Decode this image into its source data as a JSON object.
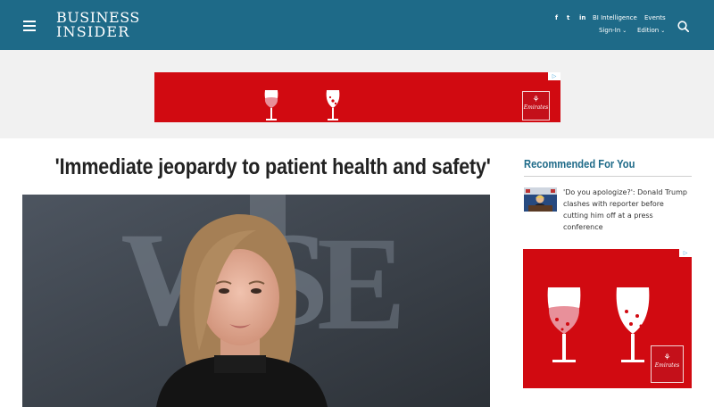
{
  "header": {
    "logo": {
      "line1": "BUSINESS",
      "line2": "INSIDER"
    },
    "social": {
      "facebook": "f",
      "twitter": "t",
      "linkedin": "in"
    },
    "links": {
      "bi_intelligence": "BI Intelligence",
      "events": "Events",
      "sign_in": "Sign-In",
      "edition": "Edition"
    }
  },
  "ads": {
    "adchoices": "▷",
    "top": {
      "brand_mark": "⚘",
      "brand_name": "Emirates"
    },
    "side": {
      "brand_mark": "⚘",
      "brand_name": "Emirates"
    }
  },
  "article": {
    "headline": "'Immediate jeopardy to patient health and safety'"
  },
  "sidebar": {
    "title": "Recommended For You",
    "items": [
      {
        "text": "'Do you apologize?': Donald Trump clashes with reporter before cutting him off at a press conference"
      }
    ]
  },
  "colors": {
    "brand_blue": "#1e6a88",
    "ad_red": "#d10a11"
  },
  "icons": {
    "menu": "hamburger-icon",
    "search": "search-icon",
    "chevron": "chevron-down-icon"
  }
}
